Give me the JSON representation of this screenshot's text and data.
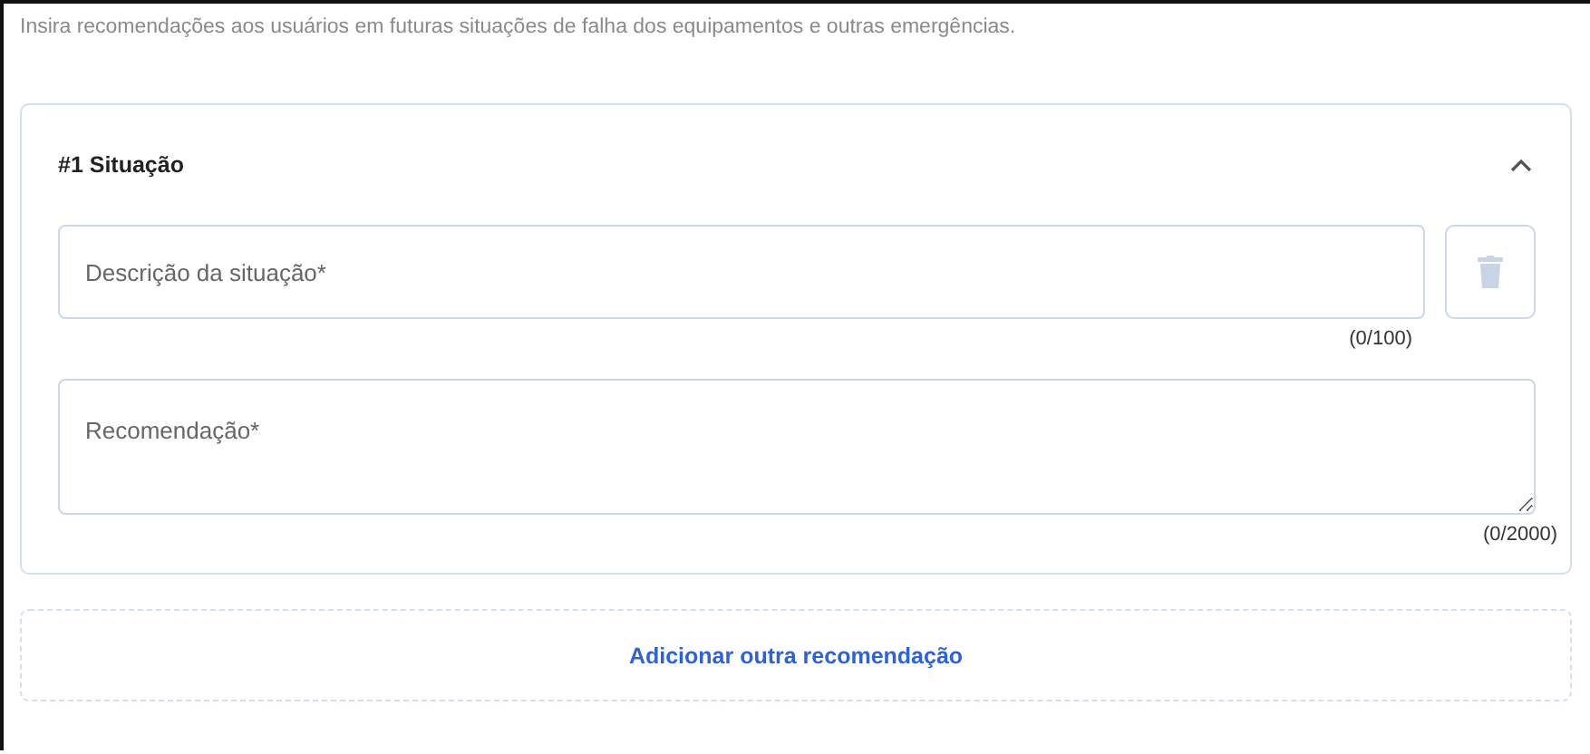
{
  "intro": "Insira recomendações aos usuários em futuras situações de falha dos equipamentos e outras emergências.",
  "situations": [
    {
      "title": "#1 Situação",
      "expanded": true,
      "description": {
        "placeholder": "Descrição da situação*",
        "counter": "(0/100)"
      },
      "recommendation": {
        "placeholder": "Recomendação*",
        "counter": "(0/2000)"
      }
    }
  ],
  "add_button": "Adicionar outra recomendação"
}
